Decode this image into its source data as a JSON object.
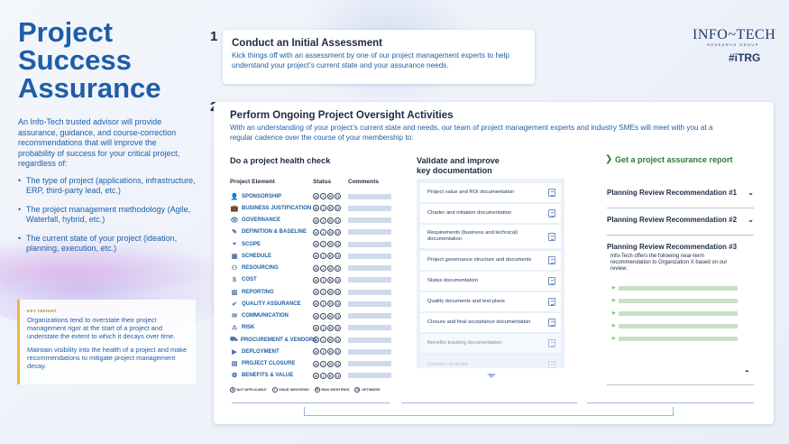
{
  "hero": {
    "title_lines": [
      "Project",
      "Success",
      "Assurance"
    ],
    "intro": "An Info-Tech trusted advisor will provide assurance, guidance, and course-correction recommendations that will improve the probability of success for your critical project, regardless of:",
    "bullets": [
      "The type of project (applications, infrastructure, ERP, third-party lead, etc.)",
      "The project management methodology (Agile, Waterfall, hybrid, etc.)",
      "The current state of your project (ideation, planning, execution, etc.)"
    ]
  },
  "insight": {
    "label": "KEY INSIGHT",
    "para1": "Organizations tend to overstate their project management rigor at the start of a project and understate the extent to which it decays over time.",
    "para2": "Maintain visibility into the health of a project and make recommendations to mitigate project management decay."
  },
  "brand": {
    "name": "INFO~TECH",
    "sub": "RESEARCH GROUP",
    "tag": "#iTRG"
  },
  "step1": {
    "number": "1",
    "title": "Conduct an Initial Assessment",
    "subtitle": "Kick things off with an assessment by one of our project management experts to help understand your project’s current state and your assurance needs."
  },
  "step2": {
    "number": "2",
    "title": "Perform Ongoing Project Oversight Activities",
    "subtitle": "With an understanding of your project’s current state and needs, our team of project management experts and industry SMEs will meet with you at a regular cadence over the course of your membership to:"
  },
  "health": {
    "title": "Do a project health check",
    "col_element": "Project Element",
    "col_status": "Status",
    "col_comments": "Comments",
    "status_letters": [
      "N",
      "I",
      "R",
      "O"
    ],
    "rows": [
      {
        "label": "SPONSORSHIP",
        "icon": "👤"
      },
      {
        "label": "BUSINESS JUSTIFICATION",
        "icon": "💼"
      },
      {
        "label": "GOVERNANCE",
        "icon": "👁"
      },
      {
        "label": "DEFINITION & BASELINE",
        "icon": "✎"
      },
      {
        "label": "SCOPE",
        "icon": "⌖"
      },
      {
        "label": "SCHEDULE",
        "icon": "▦"
      },
      {
        "label": "RESOURCING",
        "icon": "⚇"
      },
      {
        "label": "COST",
        "icon": "$"
      },
      {
        "label": "REPORTING",
        "icon": "▥"
      },
      {
        "label": "QUALITY ASSURANCE",
        "icon": "✔"
      },
      {
        "label": "COMMUNICATION",
        "icon": "✉"
      },
      {
        "label": "RISK",
        "icon": "⚠"
      },
      {
        "label": "PROCUREMENT & VENDORS",
        "icon": "⛟"
      },
      {
        "label": "DEPLOYMENT",
        "icon": "▶"
      },
      {
        "label": "PROJECT CLOSURE",
        "icon": "▤"
      },
      {
        "label": "BENEFITS & VALUE",
        "icon": "❂"
      }
    ],
    "legend": [
      {
        "letter": "N",
        "label": "NOT APPLICABLE"
      },
      {
        "letter": "I",
        "label": "ISSUE IDENTIFIED"
      },
      {
        "letter": "R",
        "label": "RISK IDENTIFIED"
      },
      {
        "letter": "O",
        "label": "OPTIMIZED"
      }
    ]
  },
  "docs": {
    "title_line1": "Validate and improve",
    "title_line2": "key documentation",
    "items": [
      "Project value and ROI documentation",
      "Charter and initiation documentation",
      "Requirements (business and technical) documentation",
      "Project governance structure and documents",
      "Status documentation",
      "Quality documents and test plans",
      "Closure and final acceptance documentation",
      "Benefits tracking documentation",
      "Contract analysis"
    ]
  },
  "report": {
    "title": "Get a project assurance report",
    "items": [
      "Planning Review Recommendation #1",
      "Planning Review Recommendation #2"
    ],
    "item3_title": "Planning Review Recommendation #3",
    "item3_text": "Info-Tech offers the following near-term recommendation to Organization X based on our review:"
  }
}
